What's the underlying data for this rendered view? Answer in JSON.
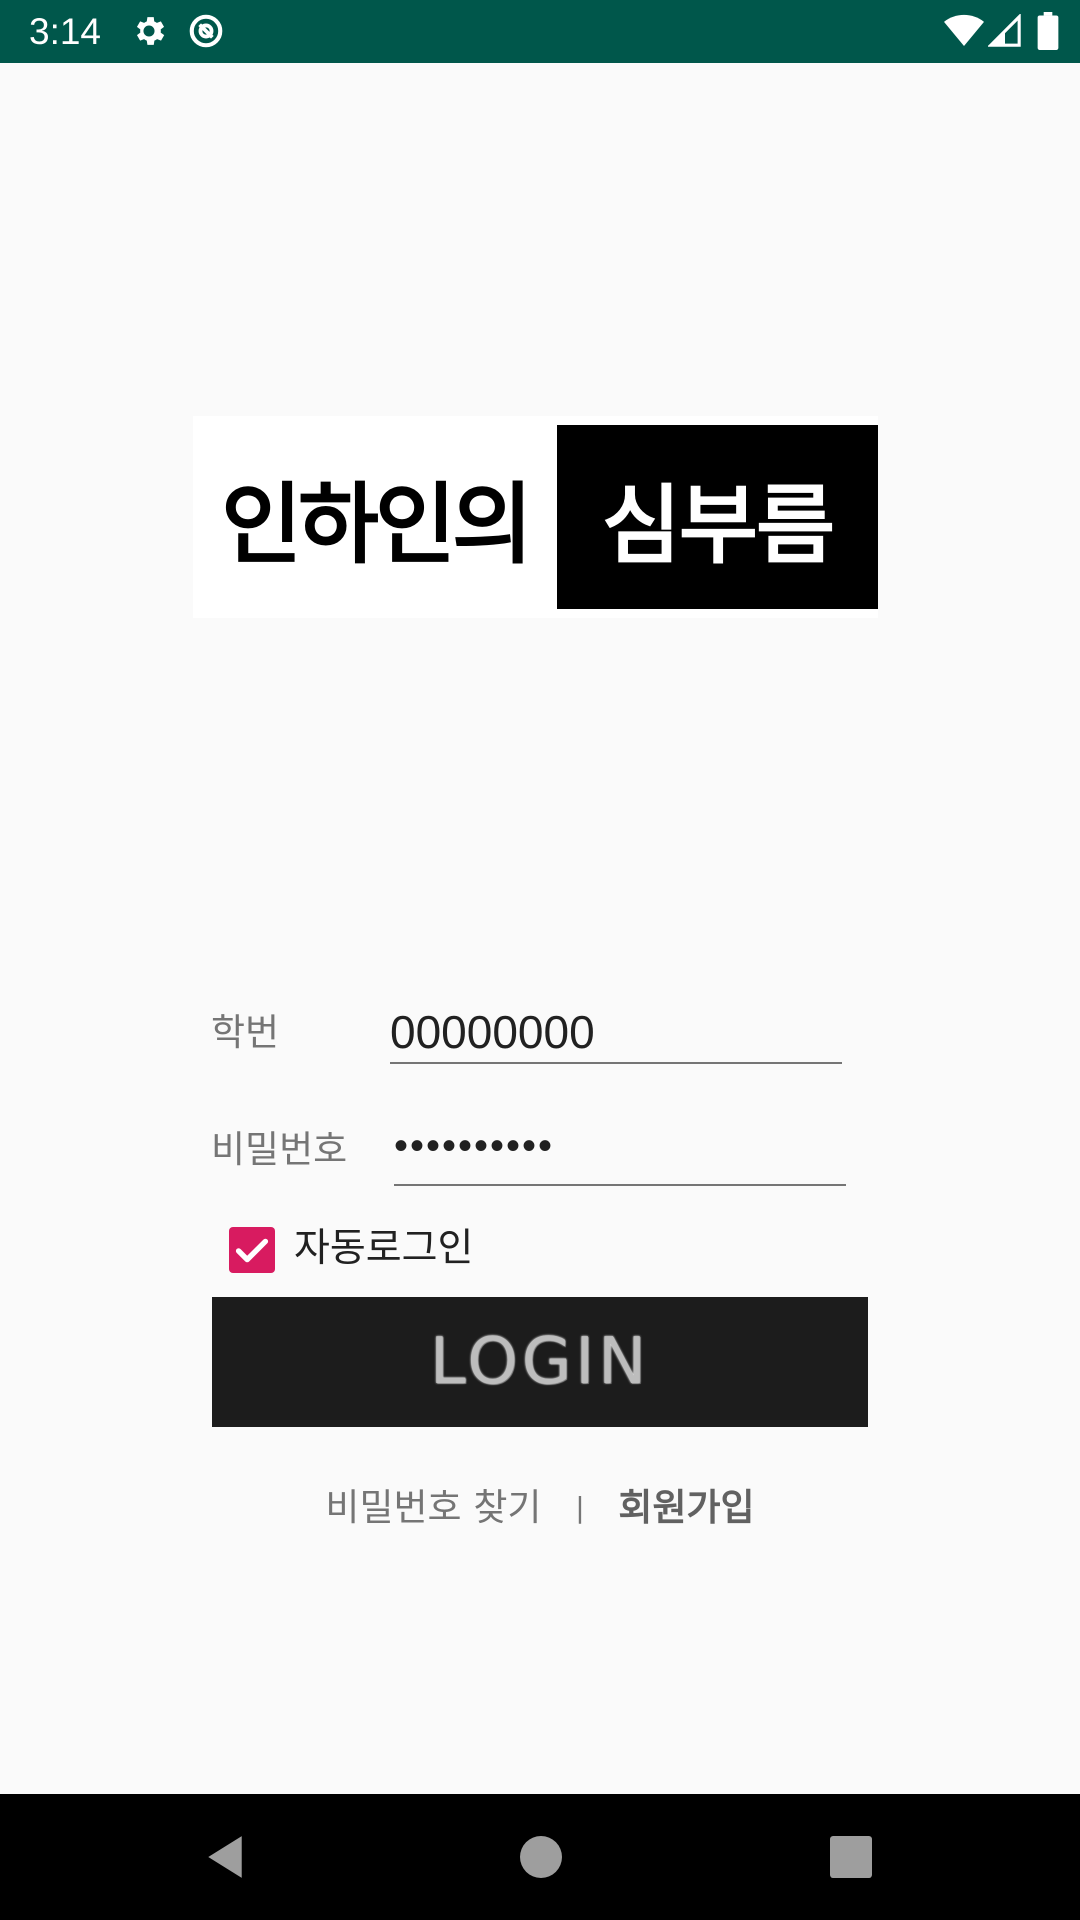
{
  "status_bar": {
    "time": "3:14",
    "icons": [
      "gear-icon",
      "cast-icon",
      "wifi-icon",
      "signal-icon",
      "battery-icon"
    ],
    "background_color": "#00574b"
  },
  "logo": {
    "left_text": "인하인의",
    "right_text": "심부름"
  },
  "form": {
    "id_label": "학번",
    "id_value": "00000000",
    "password_label": "비밀번호",
    "password_value": "••••••••••",
    "auto_login_label": "자동로그인",
    "auto_login_checked": true,
    "checkbox_color": "#d81b60",
    "login_button_label": "LOGIN"
  },
  "links": {
    "find_password": "비밀번호 찾기",
    "divider": "|",
    "sign_up": "회원가입"
  },
  "nav_bar": {
    "buttons": [
      "back-icon",
      "home-icon",
      "recents-icon"
    ]
  }
}
